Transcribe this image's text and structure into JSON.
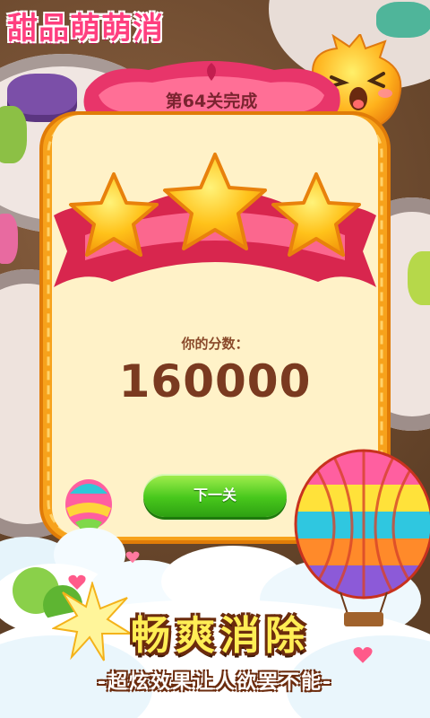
{
  "game": {
    "title": "甜品萌萌消"
  },
  "level": {
    "complete_text": "第64关完成"
  },
  "result": {
    "stars_earned": 3,
    "stars_total": 3,
    "score_label": "你的分数：",
    "score": "160000"
  },
  "actions": {
    "next_label": "下一关"
  },
  "promo": {
    "title": "畅爽消除",
    "subtitle": "-超炫效果让人欲罢不能-"
  },
  "colors": {
    "ribbon": "#e8356a",
    "panel_border": "#f7a21b",
    "panel_fill": "#fff2c8",
    "star": "#ffc21a",
    "button": "#48c81c"
  }
}
